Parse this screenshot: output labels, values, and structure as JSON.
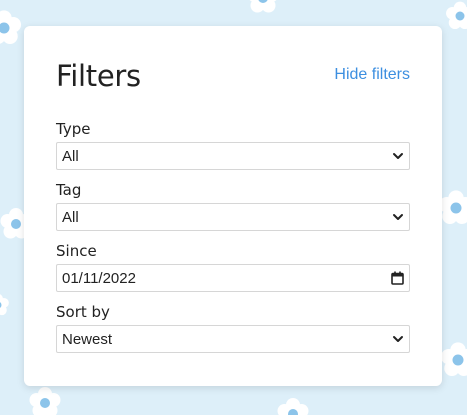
{
  "filters": {
    "title": "Filters",
    "hide_label": "Hide filters",
    "type": {
      "label": "Type",
      "value": "All"
    },
    "tag": {
      "label": "Tag",
      "value": "All"
    },
    "since": {
      "label": "Since",
      "value": "01/11/2022"
    },
    "sort": {
      "label": "Sort by",
      "value": "Newest"
    }
  },
  "colors": {
    "background": "#ddeff9",
    "link": "#3d8fe0",
    "flower_center": "#8cc4ea"
  },
  "icons": {
    "select_arrow": "chevron-down-icon",
    "date_picker": "calendar-icon"
  }
}
